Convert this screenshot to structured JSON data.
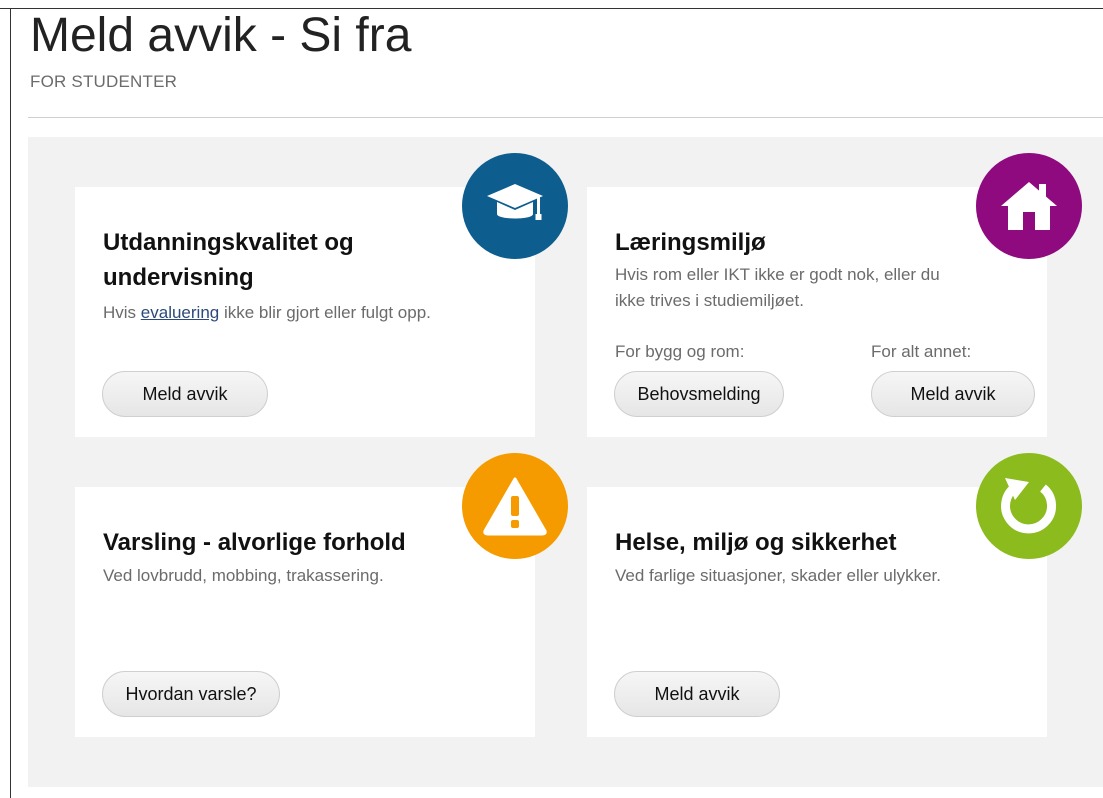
{
  "header": {
    "title": "Meld avvik - Si fra",
    "subtitle": "FOR STUDENTER"
  },
  "cards": [
    {
      "title_line1": "Utdanningskvalitet og",
      "title_line2": "undervisning",
      "desc_before": "Hvis ",
      "desc_link": "evaluering",
      "desc_after": " ikke blir gjort eller fulgt opp.",
      "button": "Meld avvik",
      "icon": "graduation-cap-icon",
      "color": "#0d5e8e"
    },
    {
      "title": "Læringsmiljø",
      "desc_line1": "Hvis rom eller IKT ikke er godt nok, eller du",
      "desc_line2": "ikke trives i studiemiljøet.",
      "label_left": "For bygg og rom:",
      "label_right": "For alt annet:",
      "button_left": "Behovsmelding",
      "button_right": "Meld avvik",
      "icon": "house-icon",
      "color": "#8e0a7e"
    },
    {
      "title": "Varsling - alvorlige forhold",
      "desc": "Ved lovbrudd, mobbing, trakassering.",
      "button": "Hvordan varsle?",
      "icon": "warning-icon",
      "color": "#f59b00"
    },
    {
      "title": "Helse, miljø og sikkerhet",
      "desc": "Ved farlige situasjoner, skader eller ulykker.",
      "button": "Meld avvik",
      "icon": "refresh-icon",
      "color": "#8cbb1e"
    }
  ]
}
